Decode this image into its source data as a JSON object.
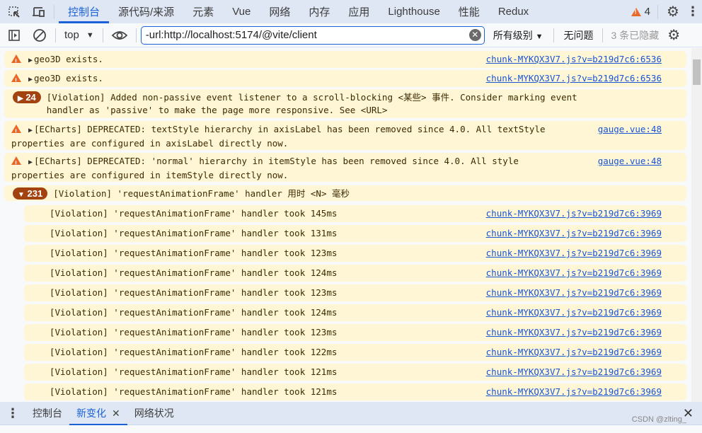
{
  "tabs": [
    "控制台",
    "源代码/来源",
    "元素",
    "Vue",
    "网络",
    "内存",
    "应用",
    "Lighthouse",
    "性能",
    "Redux"
  ],
  "issues_count": "4",
  "toolbar": {
    "context": "top",
    "filter_value": "-url:http://localhost:5174/@vite/client",
    "levels": "所有级别",
    "issues": "无问题",
    "hidden": "3 条已隐藏"
  },
  "messages": [
    {
      "type": "warning",
      "text": "geo3D exists.",
      "source": "chunk-MYKQX3V7.js?v=b219d7c6:6536"
    },
    {
      "type": "warning",
      "text": "geo3D exists.",
      "source": "chunk-MYKQX3V7.js?v=b219d7c6:6536"
    },
    {
      "type": "violation-group",
      "count": "24",
      "text": "[Violation] Added non-passive event listener to a scroll-blocking <某些> 事件. Consider marking event\nhandler as 'passive' to make the page more responsive. See <URL>"
    },
    {
      "type": "warning",
      "text": "[ECharts] DEPRECATED: textStyle hierarchy in axisLabel has been removed since 4.0. All textStyle\nproperties are configured in axisLabel directly now.",
      "source": "gauge.vue:48"
    },
    {
      "type": "warning",
      "text": "[ECharts] DEPRECATED: 'normal' hierarchy in itemStyle has been removed since 4.0. All style\nproperties are configured in itemStyle directly now.",
      "source": "gauge.vue:48"
    }
  ],
  "group": {
    "count": "231",
    "text": "[Violation] 'requestAnimationFrame' handler 用时 <N> 毫秒",
    "items": [
      {
        "text": "[Violation] 'requestAnimationFrame' handler took 145ms",
        "source": "chunk-MYKQX3V7.js?v=b219d7c6:3969"
      },
      {
        "text": "[Violation] 'requestAnimationFrame' handler took 131ms",
        "source": "chunk-MYKQX3V7.js?v=b219d7c6:3969"
      },
      {
        "text": "[Violation] 'requestAnimationFrame' handler took 123ms",
        "source": "chunk-MYKQX3V7.js?v=b219d7c6:3969"
      },
      {
        "text": "[Violation] 'requestAnimationFrame' handler took 124ms",
        "source": "chunk-MYKQX3V7.js?v=b219d7c6:3969"
      },
      {
        "text": "[Violation] 'requestAnimationFrame' handler took 123ms",
        "source": "chunk-MYKQX3V7.js?v=b219d7c6:3969"
      },
      {
        "text": "[Violation] 'requestAnimationFrame' handler took 124ms",
        "source": "chunk-MYKQX3V7.js?v=b219d7c6:3969"
      },
      {
        "text": "[Violation] 'requestAnimationFrame' handler took 123ms",
        "source": "chunk-MYKQX3V7.js?v=b219d7c6:3969"
      },
      {
        "text": "[Violation] 'requestAnimationFrame' handler took 122ms",
        "source": "chunk-MYKQX3V7.js?v=b219d7c6:3969"
      },
      {
        "text": "[Violation] 'requestAnimationFrame' handler took 121ms",
        "source": "chunk-MYKQX3V7.js?v=b219d7c6:3969"
      },
      {
        "text": "[Violation] 'requestAnimationFrame' handler took 121ms",
        "source": "chunk-MYKQX3V7.js?v=b219d7c6:3969"
      }
    ]
  },
  "drawer": {
    "tabs": [
      "控制台",
      "新变化",
      "网络状况"
    ]
  },
  "watermark": "CSDN @zlting_",
  "colors": {
    "accent": "#1a62d6",
    "warning_bg": "#fef6d5",
    "badge": "#a1420f",
    "warn_icon": "#e8682a"
  }
}
